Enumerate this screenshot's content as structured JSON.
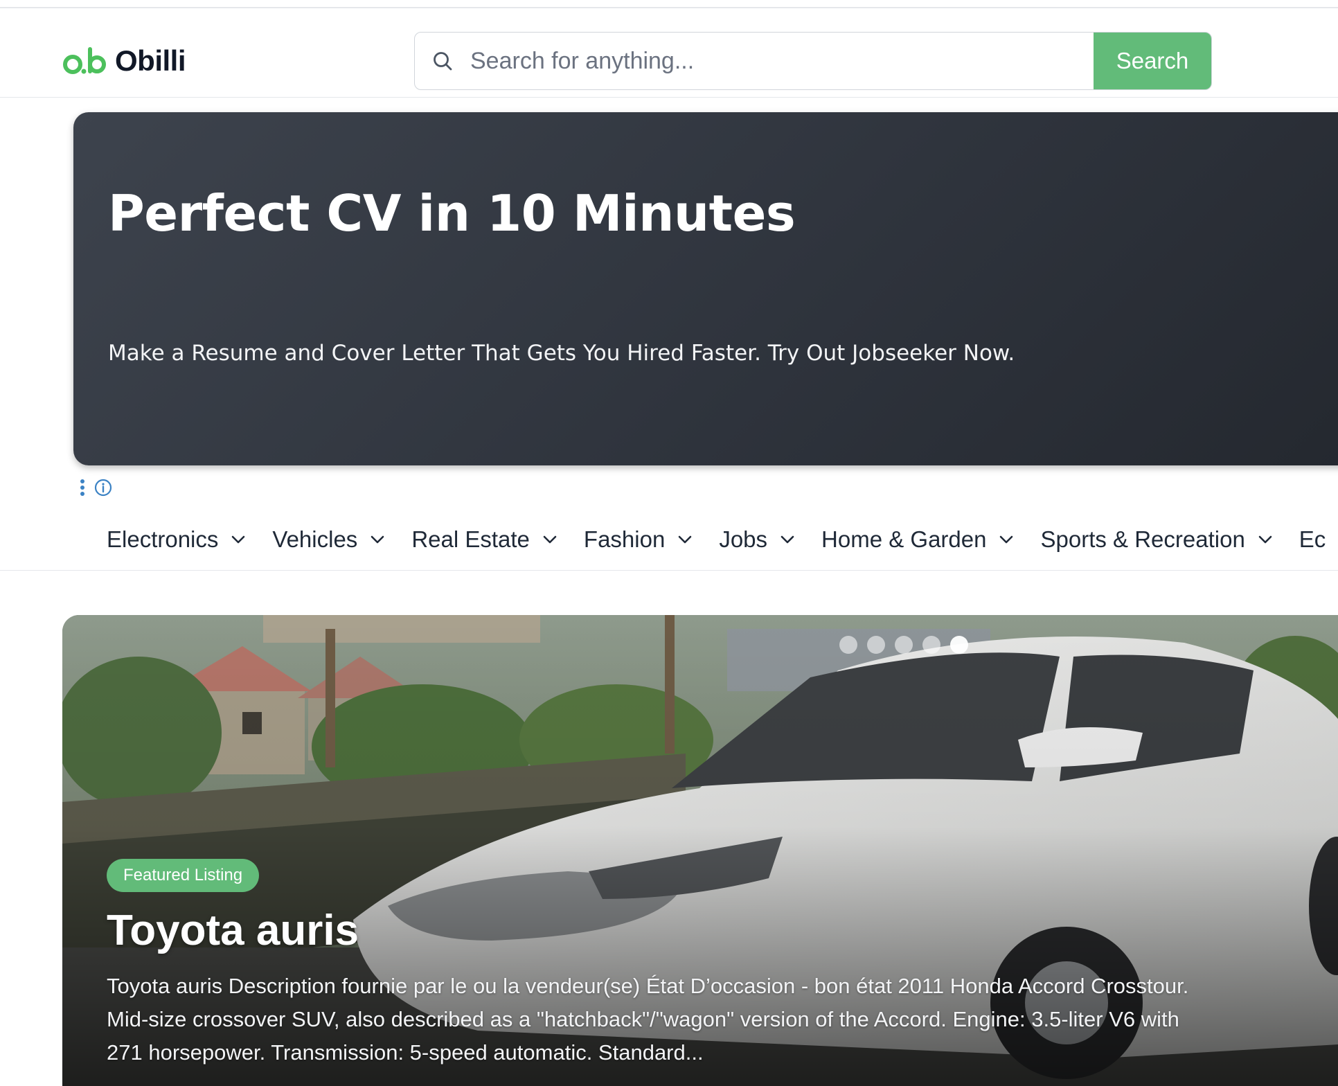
{
  "header": {
    "logo_mark": "ob",
    "brand_name": "Obilli",
    "search_placeholder": "Search for anything...",
    "search_button": "Search",
    "accent_color": "#62bb79"
  },
  "ad": {
    "title": "Perfect CV in 10 Minutes",
    "subtitle": "Make a Resume and Cover Letter That Gets You Hired Faster. Try Out Jobseeker Now.",
    "icons": [
      "more-vertical-icon",
      "info-icon"
    ]
  },
  "categories": [
    {
      "label": "Electronics"
    },
    {
      "label": "Vehicles"
    },
    {
      "label": "Real Estate"
    },
    {
      "label": "Fashion"
    },
    {
      "label": "Jobs"
    },
    {
      "label": "Home & Garden"
    },
    {
      "label": "Sports & Recreation"
    },
    {
      "label": "Ec"
    }
  ],
  "featured": {
    "badge": "Featured Listing",
    "title": "Toyota auris",
    "description": "Toyota auris Description fournie par le ou la vendeur(se) État D’occasion - bon état 2011 Honda Accord Crosstour. Mid-size crossover SUV, also described as a \"hatchback\"/\"wagon\" version of the Accord. Engine: 3.5-liter V6 with 271 horsepower. Transmission: 5-speed automatic. Standard...",
    "slide_count": 5,
    "active_slide": 5
  }
}
